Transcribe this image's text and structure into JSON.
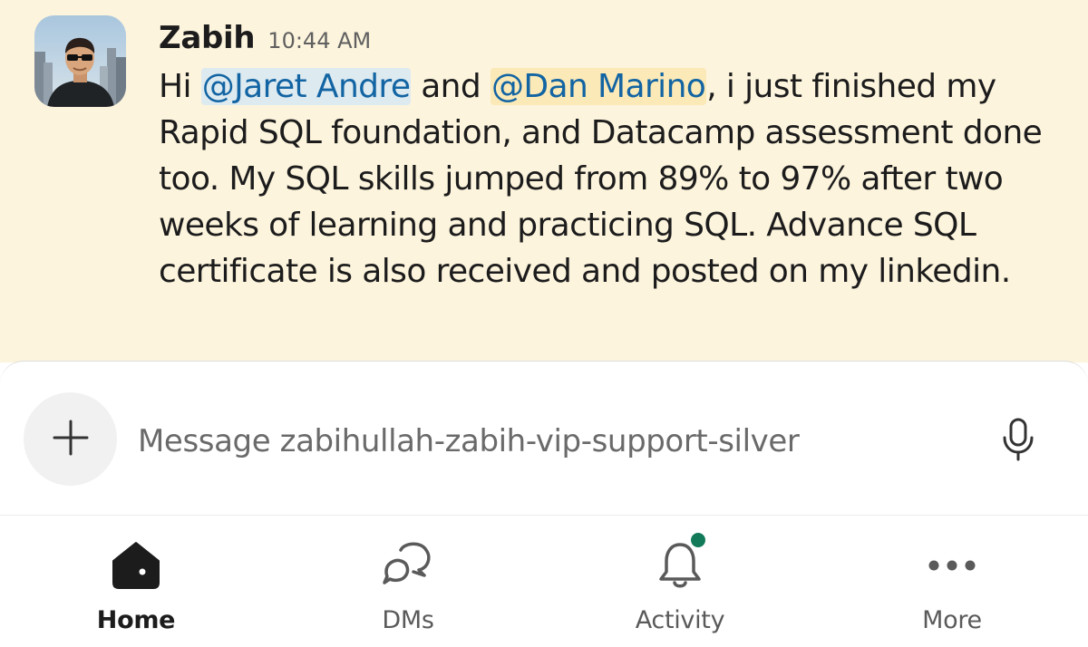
{
  "message": {
    "author": "Zabih",
    "timestamp": "10:44 AM",
    "text_before": "Hi ",
    "mention_1": "@Jaret Andre",
    "text_middle": " and ",
    "mention_2": "@Dan Marino",
    "text_after": ", i just finished my Rapid SQL foundation, and Datacamp assessment done too. My SQL skills jumped from 89% to 97% after two weeks of learning and practicing SQL. Advance SQL certificate is also received and posted on my linkedin."
  },
  "composer": {
    "placeholder": "Message zabihullah-zabih-vip-support-silver",
    "add_icon": "plus-icon",
    "mic_icon": "microphone-icon"
  },
  "tabbar": {
    "tabs": [
      {
        "label": "Home",
        "icon": "home-icon",
        "active": true
      },
      {
        "label": "DMs",
        "icon": "dms-icon",
        "active": false
      },
      {
        "label": "Activity",
        "icon": "bell-icon",
        "active": false,
        "badge": true
      },
      {
        "label": "More",
        "icon": "more-icon",
        "active": false
      }
    ]
  },
  "colors": {
    "message_highlight_bg": "#fcf4dc",
    "mention_text": "#1264a3",
    "activity_badge": "#127a59"
  }
}
